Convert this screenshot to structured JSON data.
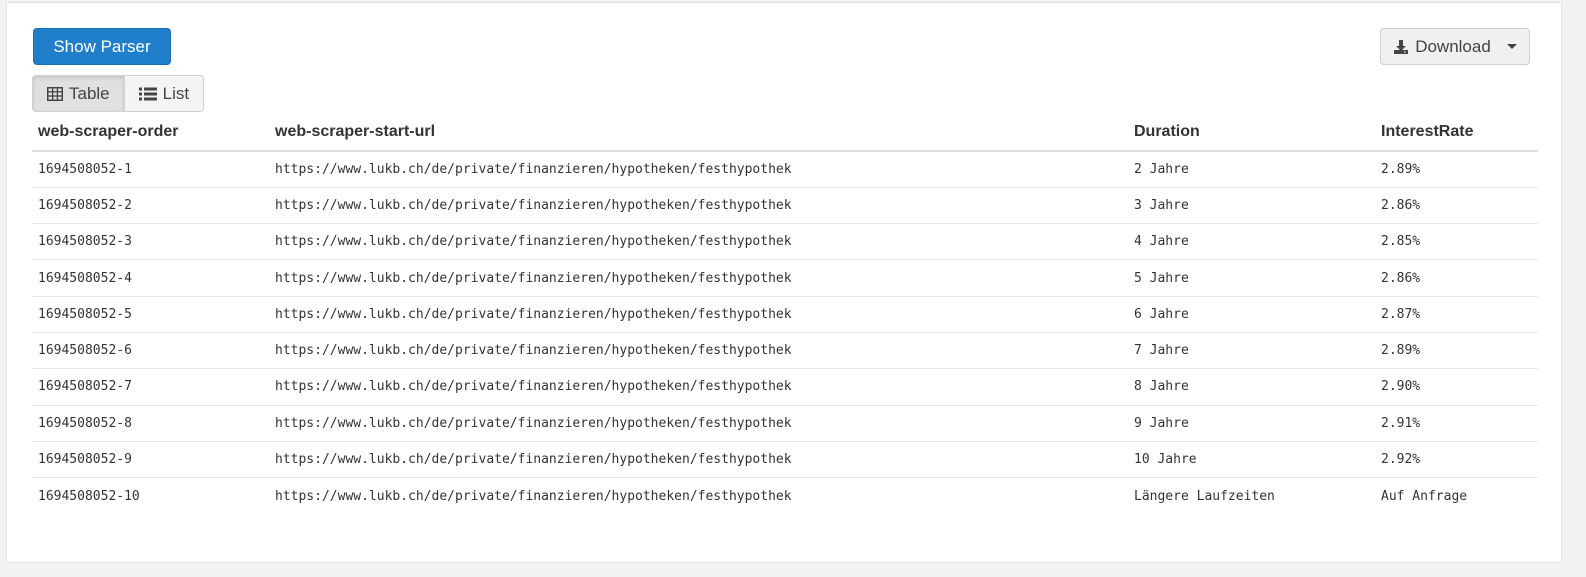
{
  "toolbar": {
    "show_parser_label": "Show Parser",
    "download_label": "Download",
    "view_table_label": "Table",
    "view_list_label": "List",
    "active_view": "Table"
  },
  "icons": {
    "download": "download-icon",
    "table": "table-icon",
    "list": "list-icon",
    "caret": "caret-down-icon"
  },
  "colors": {
    "primary": "#1f7fcb",
    "text": "#333333"
  },
  "table": {
    "headers": [
      "web-scraper-order",
      "web-scraper-start-url",
      "Duration",
      "InterestRate"
    ],
    "rows": [
      [
        "1694508052-1",
        "https://www.lukb.ch/de/private/finanzieren/hypotheken/festhypothek",
        "2 Jahre",
        "2.89%"
      ],
      [
        "1694508052-2",
        "https://www.lukb.ch/de/private/finanzieren/hypotheken/festhypothek",
        "3 Jahre",
        "2.86%"
      ],
      [
        "1694508052-3",
        "https://www.lukb.ch/de/private/finanzieren/hypotheken/festhypothek",
        "4 Jahre",
        "2.85%"
      ],
      [
        "1694508052-4",
        "https://www.lukb.ch/de/private/finanzieren/hypotheken/festhypothek",
        "5 Jahre",
        "2.86%"
      ],
      [
        "1694508052-5",
        "https://www.lukb.ch/de/private/finanzieren/hypotheken/festhypothek",
        "6 Jahre",
        "2.87%"
      ],
      [
        "1694508052-6",
        "https://www.lukb.ch/de/private/finanzieren/hypotheken/festhypothek",
        "7 Jahre",
        "2.89%"
      ],
      [
        "1694508052-7",
        "https://www.lukb.ch/de/private/finanzieren/hypotheken/festhypothek",
        "8 Jahre",
        "2.90%"
      ],
      [
        "1694508052-8",
        "https://www.lukb.ch/de/private/finanzieren/hypotheken/festhypothek",
        "9 Jahre",
        "2.91%"
      ],
      [
        "1694508052-9",
        "https://www.lukb.ch/de/private/finanzieren/hypotheken/festhypothek",
        "10 Jahre",
        "2.92%"
      ],
      [
        "1694508052-10",
        "https://www.lukb.ch/de/private/finanzieren/hypotheken/festhypothek",
        "Längere Laufzeiten",
        "Auf Anfrage"
      ]
    ]
  }
}
